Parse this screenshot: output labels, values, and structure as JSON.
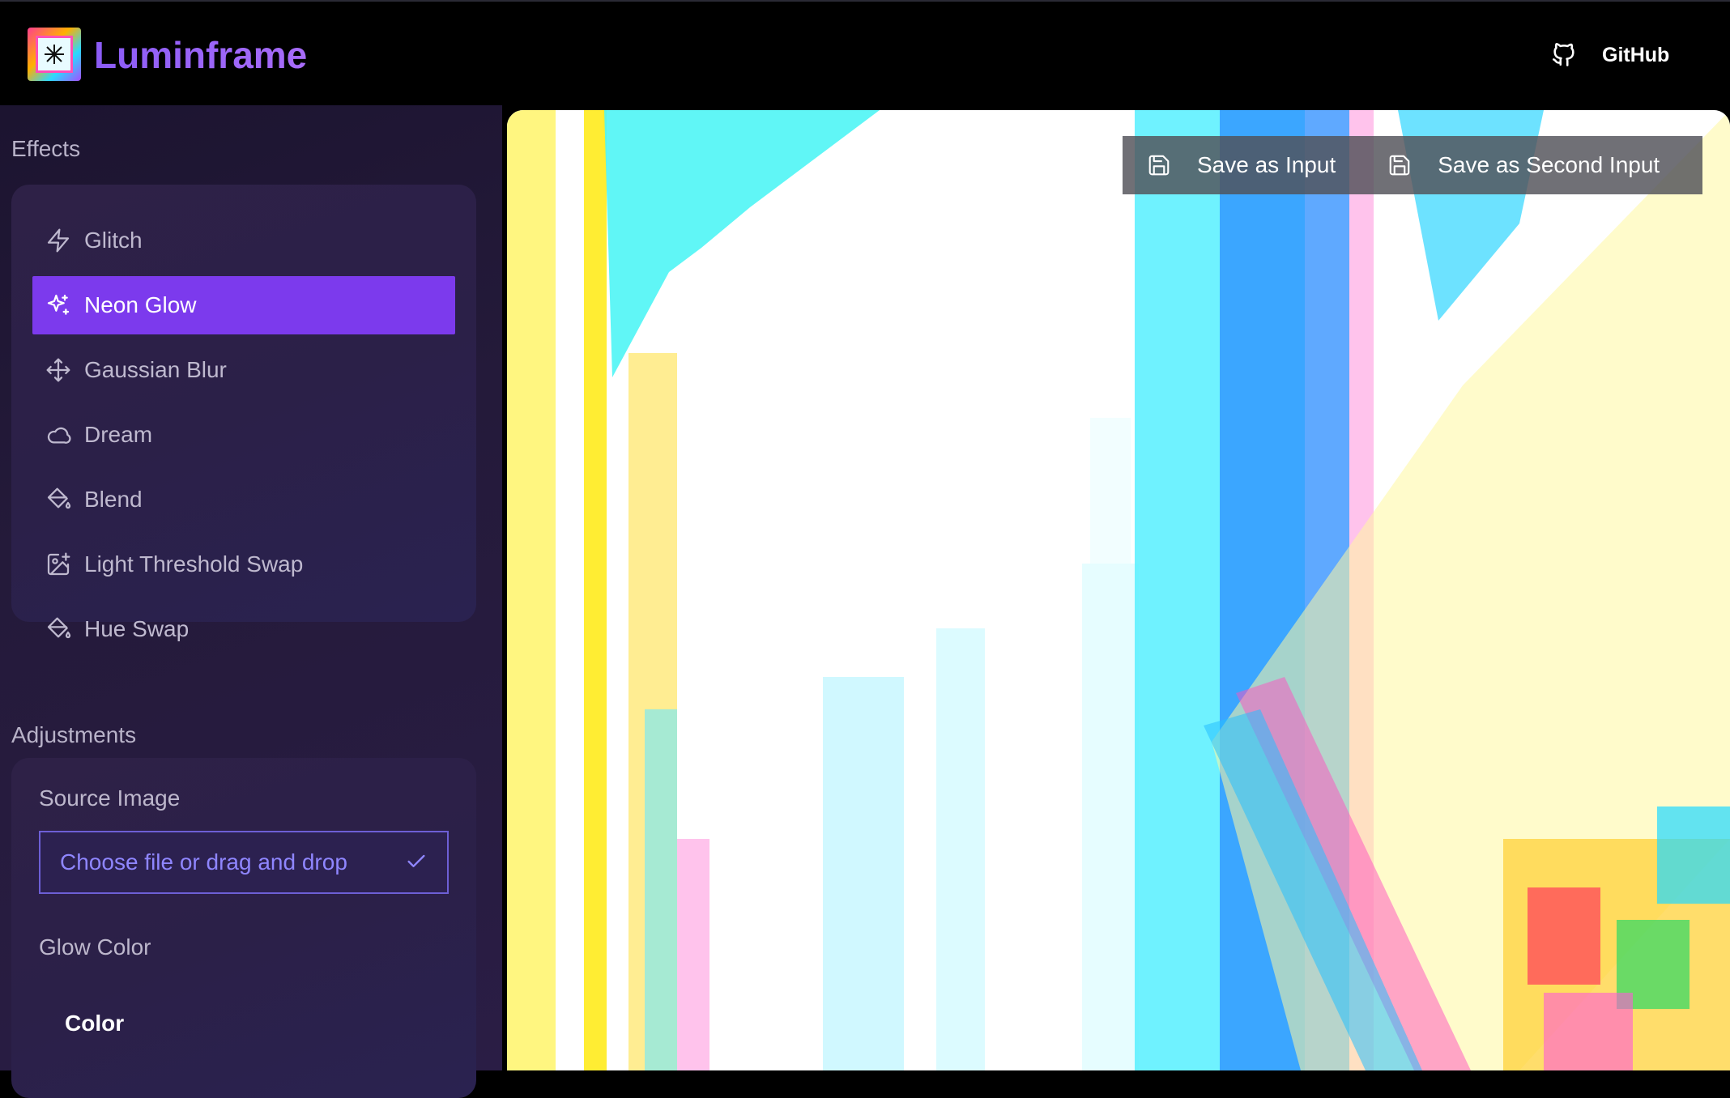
{
  "app": {
    "name": "Luminframe",
    "github_label": "GitHub"
  },
  "effects": {
    "title": "Effects",
    "items": [
      {
        "label": "Glitch",
        "icon": "lightning-icon",
        "active": false
      },
      {
        "label": "Neon Glow",
        "icon": "sparkles-icon",
        "active": true
      },
      {
        "label": "Gaussian Blur",
        "icon": "move-arrows-icon",
        "active": false
      },
      {
        "label": "Dream",
        "icon": "cloud-icon",
        "active": false
      },
      {
        "label": "Blend",
        "icon": "paint-bucket-icon",
        "active": false
      },
      {
        "label": "Light Threshold Swap",
        "icon": "image-plus-icon",
        "active": false
      },
      {
        "label": "Hue Swap",
        "icon": "paint-bucket-icon",
        "active": false
      }
    ]
  },
  "adjustments": {
    "title": "Adjustments",
    "source_image_label": "Source Image",
    "file_input_text": "Choose file or drag and drop",
    "glow_color_label": "Glow Color",
    "color_label": "Color"
  },
  "canvas": {
    "save_input_label": "Save as Input",
    "save_second_input_label": "Save as Second Input"
  },
  "colors": {
    "accent": "#7c3aed",
    "brand": "#8b5cf6",
    "file_input_text": "#8f86ff"
  }
}
